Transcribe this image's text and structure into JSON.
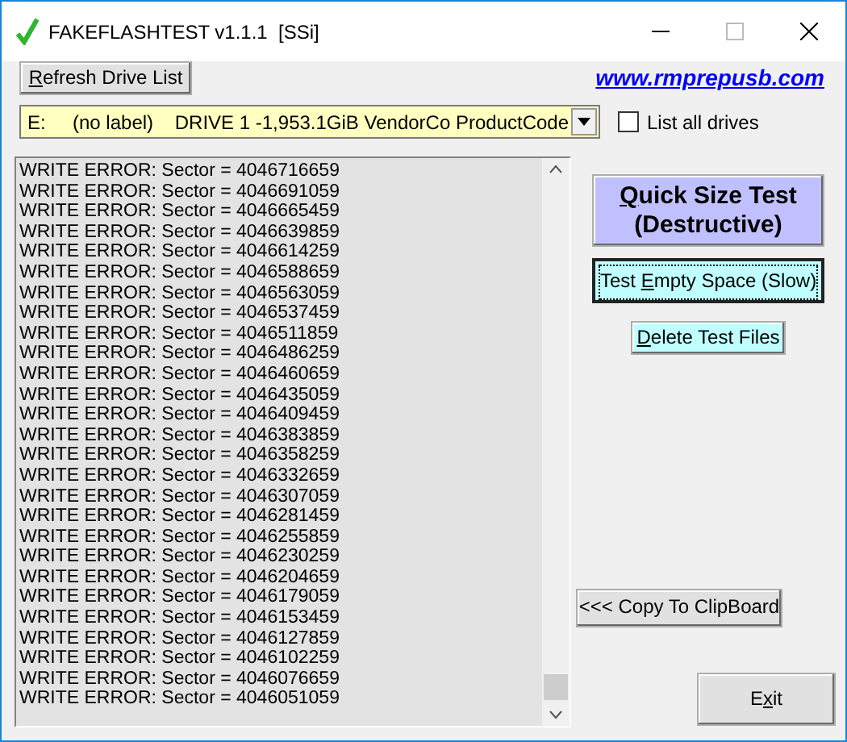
{
  "window": {
    "title": "FAKEFLASHTEST v1.1.1  [SSi]"
  },
  "refresh_button": {
    "label": {
      "key": "R",
      "after": "efresh Drive List"
    }
  },
  "link": "www.rmprepusb.com",
  "drive_select": {
    "value": "E:     (no label)    DRIVE 1 -1,953.1GiB VendorCo ProductCode"
  },
  "list_all_drives": {
    "label": "List all drives",
    "checked": false
  },
  "log": [
    "WRITE ERROR: Sector = 4046716659",
    "WRITE ERROR: Sector = 4046691059",
    "WRITE ERROR: Sector = 4046665459",
    "WRITE ERROR: Sector = 4046639859",
    "WRITE ERROR: Sector = 4046614259",
    "WRITE ERROR: Sector = 4046588659",
    "WRITE ERROR: Sector = 4046563059",
    "WRITE ERROR: Sector = 4046537459",
    "WRITE ERROR: Sector = 4046511859",
    "WRITE ERROR: Sector = 4046486259",
    "WRITE ERROR: Sector = 4046460659",
    "WRITE ERROR: Sector = 4046435059",
    "WRITE ERROR: Sector = 4046409459",
    "WRITE ERROR: Sector = 4046383859",
    "WRITE ERROR: Sector = 4046358259",
    "WRITE ERROR: Sector = 4046332659",
    "WRITE ERROR: Sector = 4046307059",
    "WRITE ERROR: Sector = 4046281459",
    "WRITE ERROR: Sector = 4046255859",
    "WRITE ERROR: Sector = 4046230259",
    "WRITE ERROR: Sector = 4046204659",
    "WRITE ERROR: Sector = 4046179059",
    "WRITE ERROR: Sector = 4046153459",
    "WRITE ERROR: Sector = 4046127859",
    "WRITE ERROR: Sector = 4046102259",
    "WRITE ERROR: Sector = 4046076659",
    "WRITE ERROR: Sector = 4046051059"
  ],
  "actions": [
    {
      "kind": "quick",
      "label": {
        "key": "Q",
        "after": "uick Size Test\n(Destructive)"
      },
      "focused": false
    },
    {
      "kind": "empty",
      "label": {
        "before": "Test ",
        "key": "E",
        "after": "mpty Space (Slow)"
      },
      "focused": true
    },
    {
      "kind": "delete",
      "label": {
        "key": "D",
        "after": "elete Test Files"
      },
      "focused": false
    }
  ],
  "copy_button": {
    "label": {
      "after": "<<< Copy To ClipBoard"
    }
  },
  "exit_button": {
    "label": {
      "before": "E",
      "key": "x",
      "after": "it"
    }
  }
}
